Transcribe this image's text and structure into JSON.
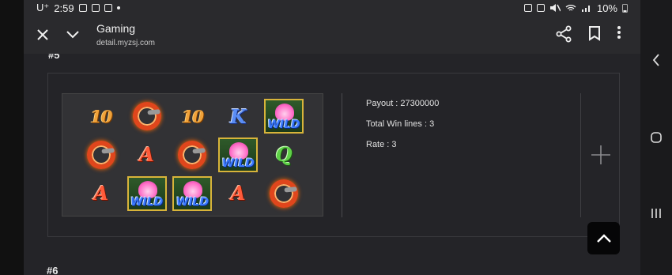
{
  "status_bar": {
    "carrier": "U⁺",
    "time": "2:59",
    "battery": "10%"
  },
  "app_bar": {
    "title": "Gaming",
    "url": "detail.myzsj.com"
  },
  "content": {
    "prev_section_label": "#5",
    "next_section_label": "#6",
    "reels": [
      [
        "10",
        "ring",
        "10",
        "K",
        "WILD"
      ],
      [
        "ring",
        "A",
        "ring",
        "WILD",
        "Q"
      ],
      [
        "A",
        "WILD",
        "WILD",
        "A",
        "ring"
      ]
    ],
    "result": {
      "payout": "Payout : 27300000",
      "win_lines": "Total Win lines : 3",
      "rate": "Rate : 3"
    }
  },
  "icons": {
    "close": "close-icon",
    "chevron": "chevron-down-icon",
    "share": "share-icon",
    "bookmark": "bookmark-icon",
    "more": "more-vertical-icon",
    "plus": "plus-icon",
    "scroll_top": "chevron-up-icon"
  },
  "colors": {
    "background": "#242428",
    "app_bar": "#2a2a2d",
    "card_border": "#3a3a3e"
  }
}
